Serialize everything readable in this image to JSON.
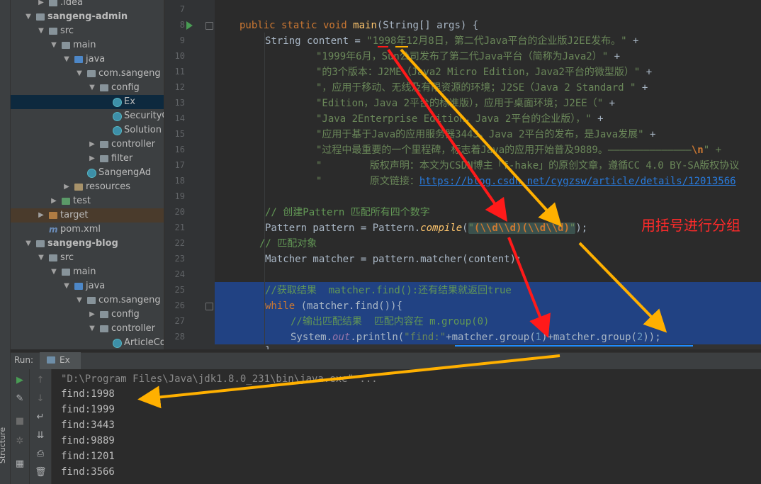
{
  "colors": {
    "accent": "#4a88c7",
    "annotation_red": "#ff2a2a",
    "arrow_orange": "#ffb000",
    "arrow_red": "#ff1a1a",
    "underline_blue": "#1e8cff"
  },
  "sidebar": {
    "structure_label": "Structure",
    "items": [
      {
        "label": ".idea",
        "icon": "folder-icon"
      },
      {
        "label": "sangeng-admin",
        "icon": "module-folder-icon"
      },
      {
        "label": "src",
        "icon": "folder-icon"
      },
      {
        "label": "main",
        "icon": "folder-icon"
      },
      {
        "label": "java",
        "icon": "source-folder-icon"
      },
      {
        "label": "com.sangeng",
        "icon": "package-icon"
      },
      {
        "label": "config",
        "icon": "package-icon"
      },
      {
        "label": "Ex",
        "icon": "java-class-icon"
      },
      {
        "label": "SecurityC",
        "icon": "java-class-icon"
      },
      {
        "label": "Solution",
        "icon": "java-class-icon"
      },
      {
        "label": "controller",
        "icon": "package-icon"
      },
      {
        "label": "filter",
        "icon": "package-icon"
      },
      {
        "label": "SangengAd",
        "icon": "java-class-icon"
      },
      {
        "label": "resources",
        "icon": "resources-folder-icon"
      },
      {
        "label": "test",
        "icon": "test-folder-icon"
      },
      {
        "label": "target",
        "icon": "target-folder-icon"
      },
      {
        "label": "pom.xml",
        "icon": "maven-icon"
      },
      {
        "label": "sangeng-blog",
        "icon": "module-folder-icon"
      },
      {
        "label": "src",
        "icon": "folder-icon"
      },
      {
        "label": "main",
        "icon": "folder-icon"
      },
      {
        "label": "java",
        "icon": "source-folder-icon"
      },
      {
        "label": "com.sangeng",
        "icon": "package-icon"
      },
      {
        "label": "config",
        "icon": "package-icon"
      },
      {
        "label": "controller",
        "icon": "package-icon"
      },
      {
        "label": "ArticleCo",
        "icon": "java-class-icon"
      }
    ]
  },
  "editor": {
    "line_numbers": [
      "7",
      "8",
      "9",
      "10",
      "11",
      "12",
      "13",
      "14",
      "15",
      "16",
      "17",
      "18",
      "19",
      "20",
      "21",
      "22",
      "23",
      "24",
      "25",
      "26",
      "27",
      "28"
    ],
    "lines": {
      "l8_kw": "public static void ",
      "l8_fn": "main",
      "l8_rest": "(String[] args) {",
      "l9_a": "String content = ",
      "l9_str": "\"1998年12月8日，第二代Java平台的企业版J2EE发布。\"",
      "l9_op": " +",
      "l10_str": "\"1999年6月，Sun公司发布了第二代Java平台（简称为Java2）\"",
      "l11_str": "\"的3个版本：J2ME（Java2 Micro Edition，Java2平台的微型版）\"",
      "l12_str": "\"，应用于移动、无线及有限资源的环境；J2SE（Java 2 Standard \"",
      "l13_str": "\"Edition，Java 2平台的标准版），应用于桌面环境；J2EE（\"",
      "l14_str": "\"Java 2Enterprise Edition，Java 2平台的企业版），\"",
      "l15_str": "\"应用于基于Java的应用服务器3443。Java 2平台的发布，是Java发展\"",
      "l16_str": "\"过程中最重要的一个里程碑，标志着Java的应用开始普及9889。——————————————",
      "l16_esc": "\\n",
      "l16_end": "\" +",
      "l17_str": "\"        版权声明：本文为CSDN博主「f-hake」的原创文章，遵循CC 4.0 BY-SA版权协议",
      "l18_str": "\"        原文链接：",
      "l18_link": "https://blog.csdn.net/cygzsw/article/details/12013566",
      "l20_cm": "// 创建Pattern 匹配所有四个数字",
      "l21_a": "Pattern pattern = Pattern.",
      "l21_fn": "compile",
      "l21_b": "(",
      "l21_q1": "\"",
      "l21_esc": "(\\\\d\\\\d)(\\\\d\\\\d)",
      "l21_q2": "\"",
      "l21_end": ");",
      "l22_cm": "// 匹配对象",
      "l23": "Matcher matcher = pattern.matcher(content);",
      "l25_cm": "//获取结果  matcher.find():还有结果就返回true",
      "l26_kw": "while",
      "l26_rest": " (matcher.find()){",
      "l27_cm": "//输出匹配结果  匹配内容在 m.group(0)",
      "l28_a": "System.",
      "l28_fld": "out",
      "l28_b": ".println(",
      "l28_str": "\"find:\"",
      "l28_c": "+matcher.group(",
      "l28_n1": "1",
      "l28_d": ")+matcher.group(",
      "l28_n2": "2",
      "l28_e": "));",
      "l29": "}"
    },
    "annotation": "用括号进行分组"
  },
  "run_panel": {
    "label": "Run:",
    "tab": "Ex",
    "command": "\"D:\\Program Files\\Java\\jdk1.8.0_231\\bin\\java.exe\" ...",
    "output": [
      "find:1998",
      "find:1999",
      "find:3443",
      "find:9889",
      "find:1201",
      "find:3566"
    ]
  }
}
